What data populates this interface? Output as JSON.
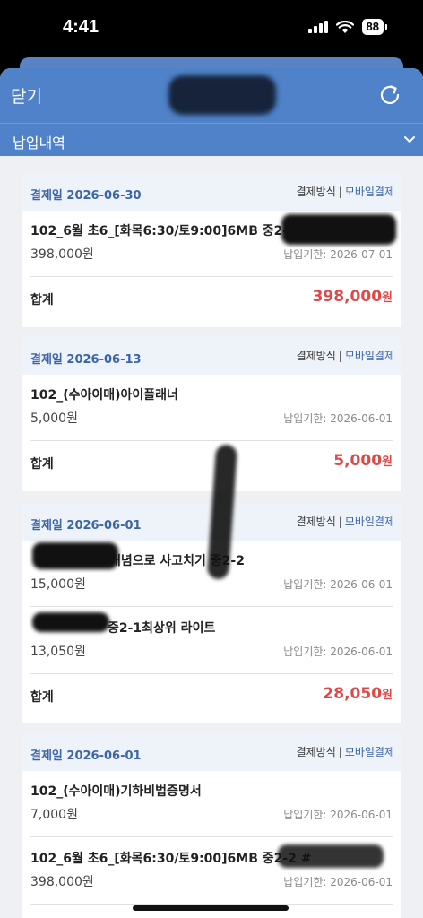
{
  "status": {
    "time": "4:41",
    "battery": "88"
  },
  "header": {
    "close_label": "닫기",
    "subheader_label": "납입내역"
  },
  "colors": {
    "accent": "#4f82c8",
    "total_red": "#e04848",
    "date_blue": "#3b65a8"
  },
  "payments": [
    {
      "date_label": "결제일 2026-06-30",
      "method_label": "결제방식",
      "method_value": "모바일결제",
      "items": [
        {
          "name": "102_6월 초6_[화목6:30/토9:00]6MB 중2-2 #",
          "price": "398,000원",
          "due": "납입기한: 2026-07-01"
        }
      ],
      "total_label": "합계",
      "total_value": "398,000",
      "total_unit": "원"
    },
    {
      "date_label": "결제일 2026-06-13",
      "method_label": "결제방식",
      "method_value": "모바일결제",
      "items": [
        {
          "name": "102_(수아이매)아이플래너",
          "price": "5,000원",
          "due": "납입기한: 2026-06-01"
        }
      ],
      "total_label": "합계",
      "total_value": "5,000",
      "total_unit": "원"
    },
    {
      "date_label": "결제일 2026-06-01",
      "method_label": "결제방식",
      "method_value": "모바일결제",
      "items": [
        {
          "name": "개념으로 사고치기 중2-2",
          "price": "15,000원",
          "due": "납입기한: 2026-06-01"
        },
        {
          "name": "중2-1최상위 라이트",
          "price": "13,050원",
          "due": "납입기한: 2026-06-01"
        }
      ],
      "total_label": "합계",
      "total_value": "28,050",
      "total_unit": "원"
    },
    {
      "date_label": "결제일 2026-06-01",
      "method_label": "결제방식",
      "method_value": "모바일결제",
      "items": [
        {
          "name": "102_(수아이매)기하비법증명서",
          "price": "7,000원",
          "due": "납입기한: 2026-06-01"
        },
        {
          "name": "102_6월 초6_[화목6:30/토9:00]6MB 중2-2 #",
          "price": "398,000원",
          "due": "납입기한: 2026-06-01"
        }
      ]
    }
  ]
}
